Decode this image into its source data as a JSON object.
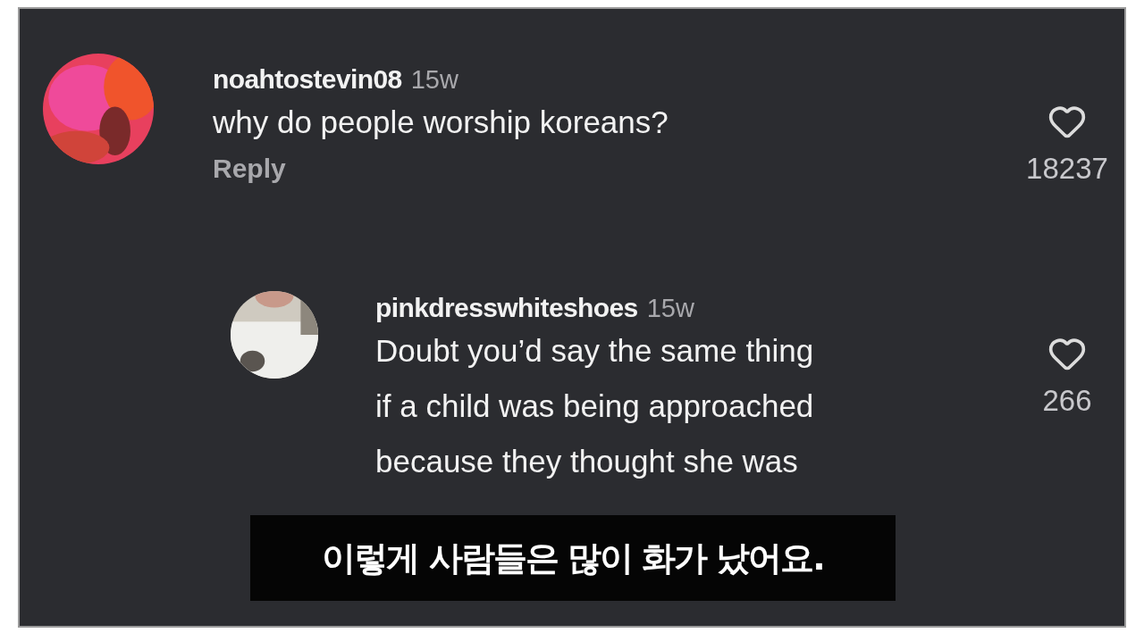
{
  "comments": [
    {
      "username": "noahtostevin08",
      "age": "15w",
      "lines": [
        "why do people worship koreans?"
      ],
      "reply": "Reply",
      "likes": "18237",
      "avatar": {
        "kind": "picture"
      }
    },
    {
      "username": "pinkdresswhiteshoes",
      "age": "15w",
      "lines": [
        "Doubt you’d say the same thing",
        "if a child was being approached",
        "because they thought she was"
      ],
      "likes": "266",
      "avatar": {
        "kind": "picture"
      }
    }
  ],
  "subtitle": "이렇게 사람들은 많이 화가 났어요."
}
